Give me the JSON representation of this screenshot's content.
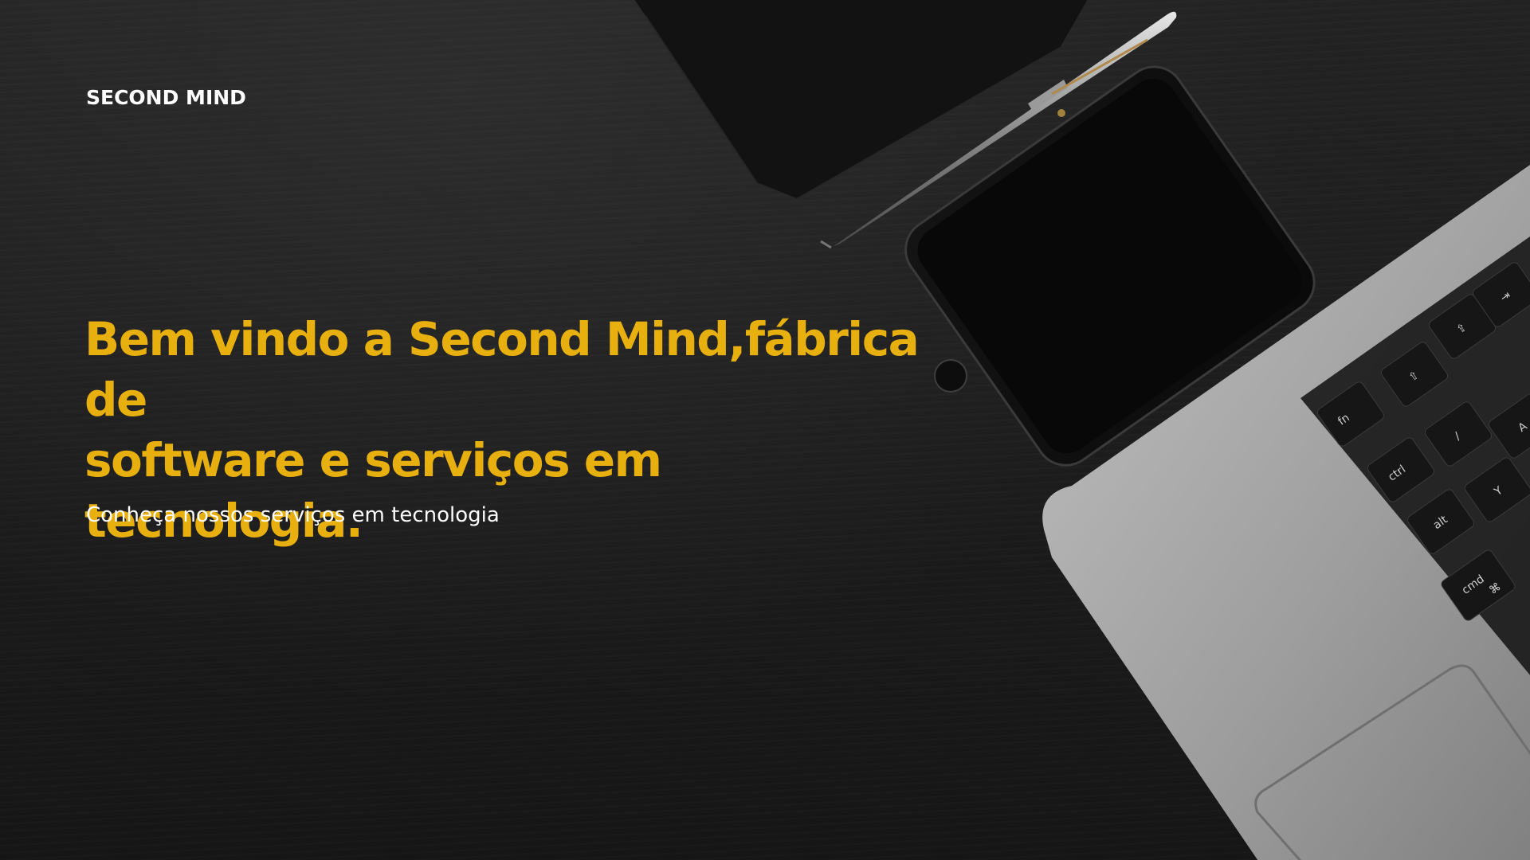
{
  "hero": {
    "brand": "SECOND MIND",
    "headline_line1": "Bem vindo a Second Mind,fábrica de",
    "headline_line2": "software e serviços em tecnologia.",
    "subtitle": "Conheça nossos serviços em tecnologia"
  },
  "keyboard": {
    "keys": [
      "fn",
      "ctrl",
      "alt",
      "cmd",
      "⌘",
      "⇧",
      "⇪",
      "⇥",
      "/",
      "Y",
      "A"
    ]
  },
  "colors": {
    "accent": "#e8b00f",
    "background": "#1c1c1c",
    "text": "#ffffff",
    "laptop": "#a9a9a9"
  }
}
